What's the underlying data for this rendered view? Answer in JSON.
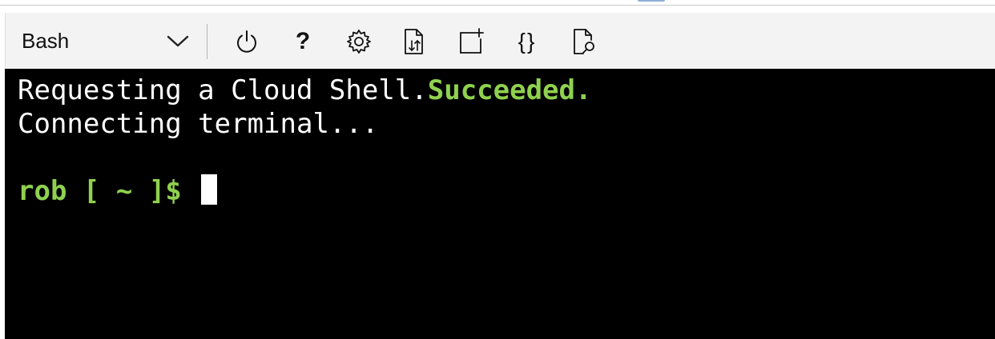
{
  "toolbar": {
    "shell_type": "Bash",
    "help_glyph": "?",
    "braces_glyph": "{}",
    "buttons": [
      {
        "name": "restart",
        "icon": "power-icon"
      },
      {
        "name": "help",
        "icon": "help-icon"
      },
      {
        "name": "settings",
        "icon": "gear-icon"
      },
      {
        "name": "upload-download",
        "icon": "file-transfer-icon"
      },
      {
        "name": "new-session",
        "icon": "new-session-icon"
      },
      {
        "name": "editor",
        "icon": "braces-icon"
      },
      {
        "name": "web-preview",
        "icon": "file-preview-icon"
      }
    ]
  },
  "terminal": {
    "line1_text": "Requesting a Cloud Shell.",
    "line1_status": "Succeeded.",
    "line2_text": "Connecting terminal...",
    "prompt": "rob [ ~ ]$ "
  },
  "colors": {
    "toolbar_bg": "#f3f3f3",
    "terminal_bg": "#000000",
    "terminal_text": "#ffffff",
    "accent_green": "#8fd14f"
  }
}
